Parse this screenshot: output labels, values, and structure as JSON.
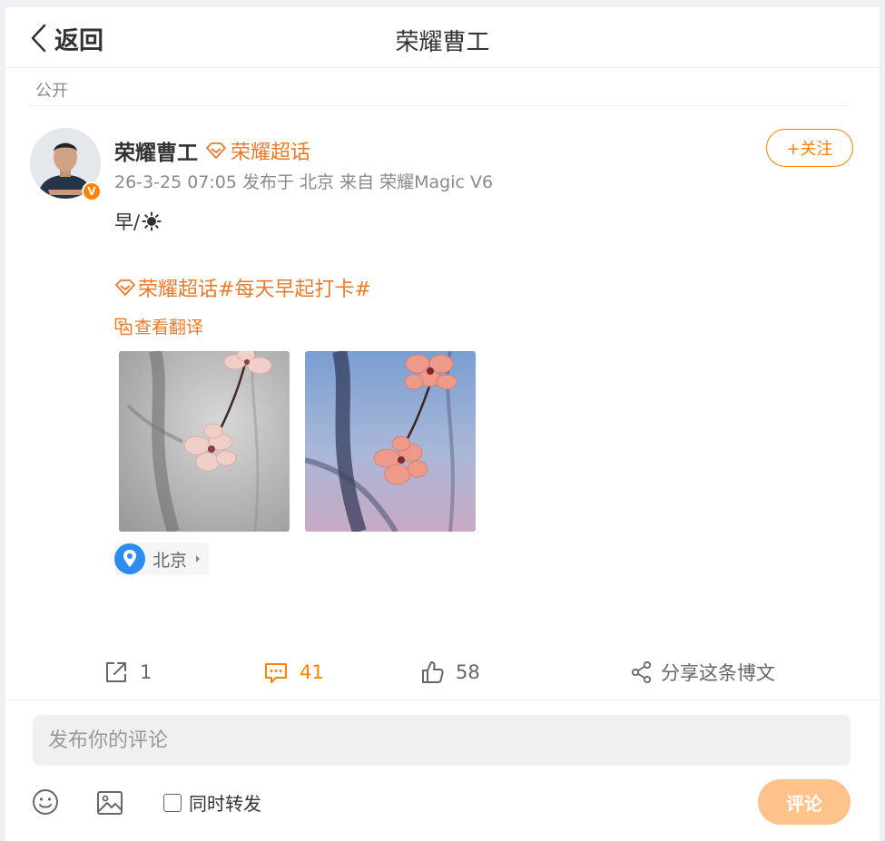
{
  "header": {
    "back_label": "返回",
    "title": "荣耀曹工"
  },
  "post": {
    "visibility": "公开",
    "author_name": "荣耀曹工",
    "super_topic_label": "荣耀超话",
    "meta": "26-3-25 07:05 发布于 北京 来自 荣耀Magic V6",
    "follow_label": "+关注",
    "text_line1": "早/",
    "topic_super": "荣耀超话",
    "topic_hashtag": "#每天早起打卡#",
    "translate_label": "查看翻译",
    "location": "北京"
  },
  "actions": {
    "repost_count": "1",
    "comment_count": "41",
    "like_count": "58",
    "share_label": "分享这条博文"
  },
  "composer": {
    "placeholder": "发布你的评论",
    "forward_label": "同时转发",
    "submit_label": "评论"
  },
  "colors": {
    "accent": "#ff8200",
    "topic": "#ea7b2a",
    "submit_disabled": "#ffc28a"
  },
  "icons": [
    "chevron-left-icon",
    "diamond-icon",
    "sun-icon",
    "translate-icon",
    "location-pin-icon",
    "repost-icon",
    "comment-icon",
    "like-icon",
    "share-icon",
    "emoji-icon",
    "image-icon"
  ]
}
